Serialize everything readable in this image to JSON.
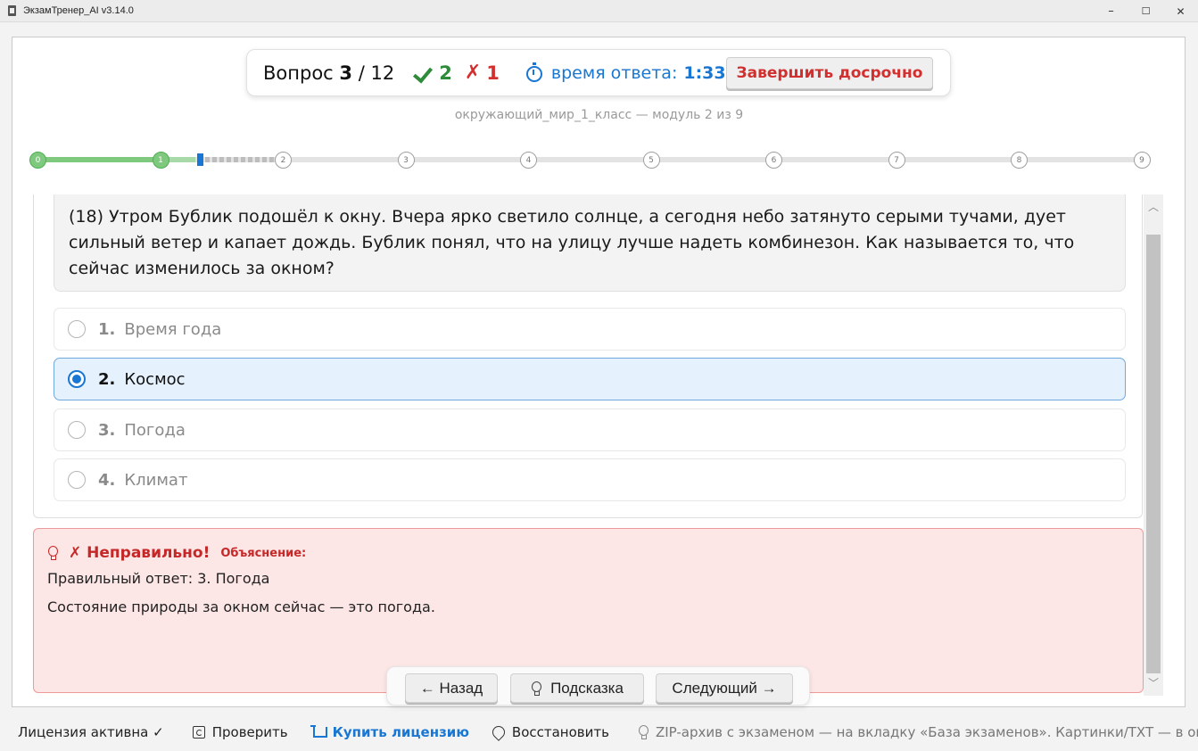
{
  "window": {
    "title": "ЭкзамТренер_AI v3.14.0",
    "minimize": "–",
    "maximize": "☐",
    "close": "✕"
  },
  "header": {
    "question_word": "Вопрос",
    "question_current": "3",
    "question_sep": "/",
    "question_total": "12",
    "correct_count": "2",
    "wrong_symbol": "✗",
    "wrong_count": "1",
    "timer_label": "время ответа:",
    "timer_value": "1:33",
    "finish_button": "Завершить досрочно",
    "module_caption": "окружающий_мир_1_класс — модуль 2 из 9"
  },
  "progress": {
    "nodes": [
      "0",
      "1",
      "2",
      "3",
      "4",
      "5",
      "6",
      "7",
      "8",
      "9"
    ],
    "completed_modules": 1,
    "current_module_fraction": 0.25
  },
  "question": {
    "text": "(18) Утром Бублик подошёл к окну. Вчера ярко светило солнце, а сегодня небо затянуто серыми тучами, дует сильный ветер и капает дождь. Бублик понял, что на улицу лучше надеть комбинезон. Как называется то, что сейчас изменилось за окном?"
  },
  "options": [
    {
      "num": "1.",
      "text": "Время года",
      "selected": false
    },
    {
      "num": "2.",
      "text": "Космос",
      "selected": true
    },
    {
      "num": "3.",
      "text": "Погода",
      "selected": false
    },
    {
      "num": "4.",
      "text": "Климат",
      "selected": false
    }
  ],
  "feedback": {
    "status": "✗ Неправильно!",
    "explanation_label": "Объяснение:",
    "correct_answer": "Правильный ответ: 3. Погода",
    "explanation": "Состояние природы за окном сейчас — это погода."
  },
  "nav": {
    "back": "← Назад",
    "hint": "Подсказка",
    "next": "Следующий →"
  },
  "statusbar": {
    "license": "Лицензия активна ✓",
    "check": "Проверить",
    "buy": "Купить лицензию",
    "restore": "Восстановить",
    "hint": "ZIP-архив с экзаменом — на вкладку «База экзаменов». Картинки/TXT — в окно «Собрать экзаме"
  },
  "colors": {
    "accent": "#1976d2",
    "correct": "#2e8b3a",
    "wrong": "#d32f2f",
    "feedback_bg": "#fde6e6"
  }
}
